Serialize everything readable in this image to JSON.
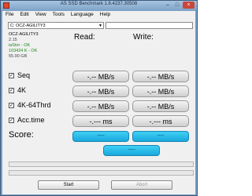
{
  "window": {
    "title": "AS SSD Benchmark 1.6.4237.30508"
  },
  "menu": [
    "File",
    "Edit",
    "View",
    "Tools",
    "Language",
    "Help"
  ],
  "drive": {
    "selected": "C: OCZ-AGILITY3"
  },
  "info": {
    "name": "OCZ-AGILITY3",
    "firmware": "2.15",
    "driver": "iaStor - OK",
    "alignment": "103424 K - OK",
    "size": "55.90 GB"
  },
  "headers": {
    "read": "Read:",
    "write": "Write:"
  },
  "rows": [
    {
      "label": "Seq",
      "read": "-.-- MB/s",
      "write": "-.-- MB/s"
    },
    {
      "label": "4K",
      "read": "-.-- MB/s",
      "write": "-.-- MB/s"
    },
    {
      "label": "4K-64Thrd",
      "read": "-.-- MB/s",
      "write": "-.-- MB/s"
    },
    {
      "label": "Acc.time",
      "read": "-.--- ms",
      "write": "-.--- ms"
    }
  ],
  "score": {
    "label": "Score:",
    "read": "----",
    "write": "----",
    "total": "----"
  },
  "buttons": {
    "start": "Start",
    "abort": "Abort"
  },
  "checkbox_mark": "✓",
  "colors": {
    "score_fill": "#19a8dd",
    "titlebar": "#7fa4ca"
  }
}
